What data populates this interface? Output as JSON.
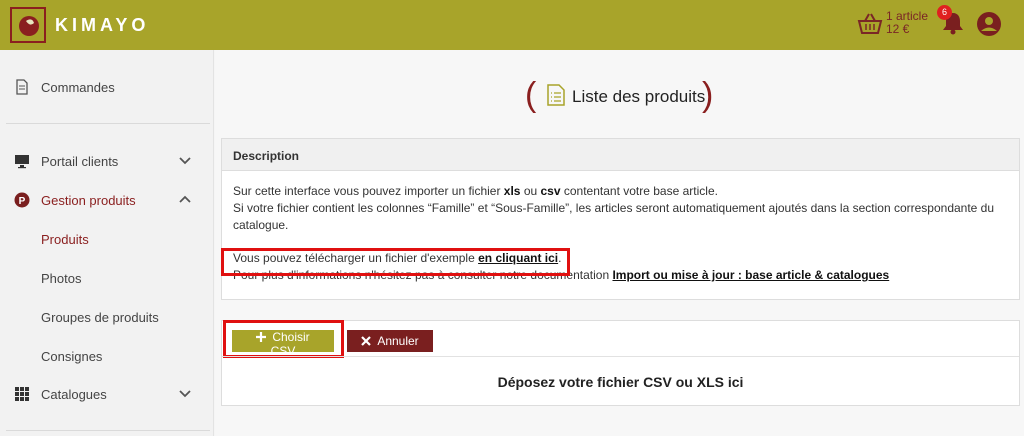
{
  "brand": {
    "name": "KIMAYO"
  },
  "header": {
    "cart_line1": "1 article",
    "cart_line2": "12 €",
    "notifications_count": "6"
  },
  "sidebar": {
    "orders": "Commandes",
    "client_portal": "Portail clients",
    "product_management": "Gestion produits",
    "sub_products": "Produits",
    "sub_photos": "Photos",
    "sub_product_groups": "Groupes de produits",
    "sub_deposits": "Consignes",
    "catalogs": "Catalogues"
  },
  "page": {
    "title": "Liste des produits"
  },
  "description": {
    "header": "Description",
    "line1_pre": "Sur cette interface vous pouvez importer un fichier ",
    "line1_xls": "xls",
    "line1_mid": " ou ",
    "line1_csv": "csv",
    "line1_post": " contentant votre base article.",
    "line2": "Si votre fichier contient les colonnes “Famille” et “Sous-Famille”, les articles seront automatiquement ajoutés dans la section correspondante du catalogue.",
    "line3_pre": "Vous pouvez télécharger un fichier d'exemple ",
    "line3_link": "en cliquant ici",
    "line3_post": ".",
    "line4_pre": "Pour plus d'informations n'hésitez pas à consulter notre documentation ",
    "line4_link": "Import ou mise à jour : base article & catalogues"
  },
  "upload": {
    "choose_csv": "Choisir CSV",
    "cancel": "Annuler",
    "drop_text": "Déposez votre fichier CSV ou XLS ici"
  },
  "colors": {
    "brand_green": "#a8a42a",
    "brand_red": "#7a1f1f",
    "highlight": "#e01010"
  }
}
